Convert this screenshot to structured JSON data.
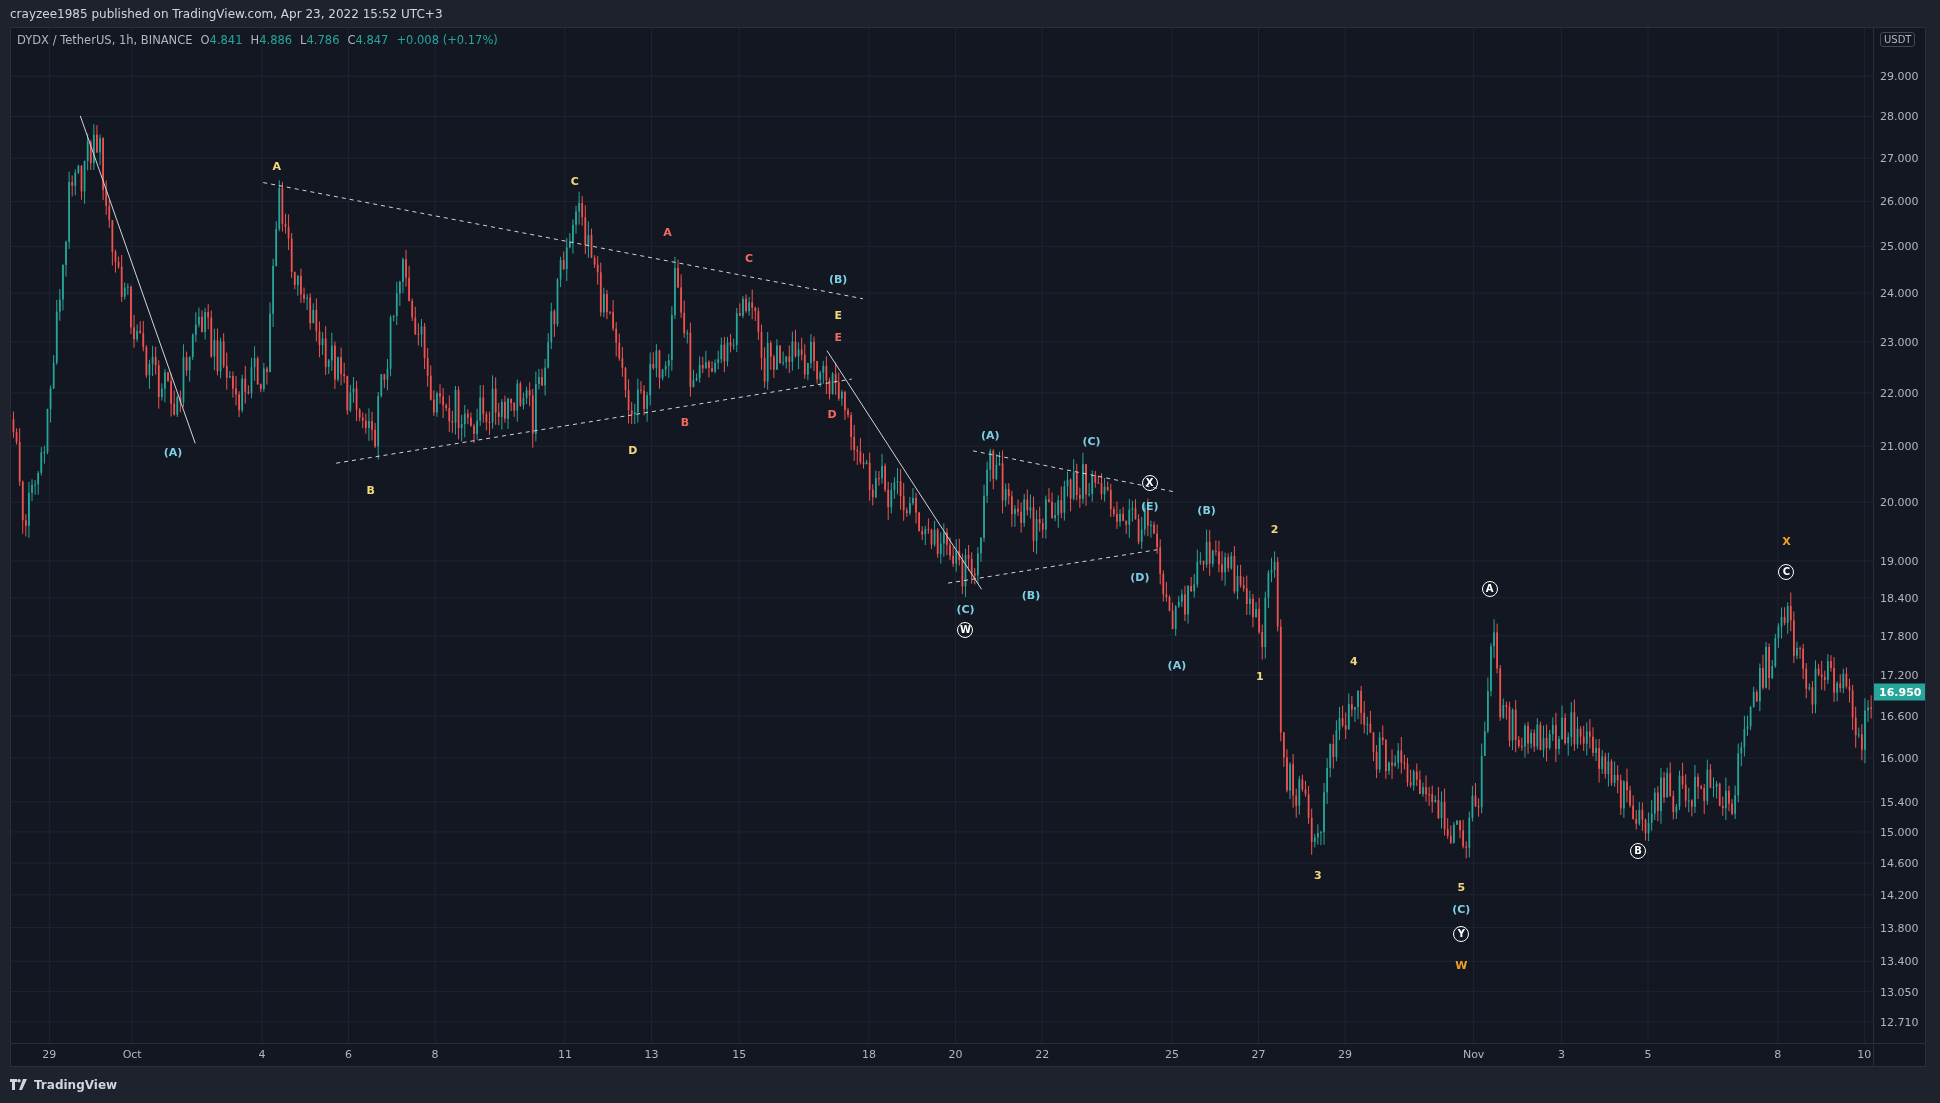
{
  "header": {
    "text": "crayzee1985 published on TradingView.com, Apr 23, 2022 15:52 UTC+3"
  },
  "legend": {
    "symbol": "DYDX / TetherUS, 1h, BINANCE",
    "fields": [
      {
        "key": "O",
        "value": "4.841"
      },
      {
        "key": "H",
        "value": "4.886"
      },
      {
        "key": "L",
        "value": "4.786"
      },
      {
        "key": "C",
        "value": "4.847"
      }
    ],
    "change": "+0.008 (+0.17%)"
  },
  "price_axis": {
    "currency": "USDT",
    "ticks": [
      "29.000",
      "28.000",
      "27.000",
      "26.000",
      "25.000",
      "24.000",
      "23.000",
      "22.000",
      "21.000",
      "20.000",
      "19.000",
      "18.400",
      "17.800",
      "17.200",
      "16.600",
      "16.000",
      "15.400",
      "15.000",
      "14.600",
      "14.200",
      "13.800",
      "13.400",
      "13.050",
      "12.710"
    ],
    "last_price": "16.950"
  },
  "time_axis": {
    "ticks": [
      "29",
      "Oct",
      "4",
      "6",
      "8",
      "11",
      "13",
      "15",
      "18",
      "20",
      "22",
      "25",
      "27",
      "29",
      "Nov",
      "3",
      "5",
      "8",
      "10"
    ]
  },
  "wave_labels": [
    {
      "text": "(A)",
      "kind": "plain",
      "color": "#7dcfe3"
    },
    {
      "text": "A",
      "kind": "plain",
      "color": "#f3d97a"
    },
    {
      "text": "B",
      "kind": "plain",
      "color": "#f3d97a"
    },
    {
      "text": "C",
      "kind": "plain",
      "color": "#f3d97a"
    },
    {
      "text": "D",
      "kind": "plain",
      "color": "#f3d97a"
    },
    {
      "text": "A",
      "kind": "plain",
      "color": "#f06a62"
    },
    {
      "text": "B",
      "kind": "plain",
      "color": "#f06a62"
    },
    {
      "text": "C",
      "kind": "plain",
      "color": "#f06a62"
    },
    {
      "text": "D",
      "kind": "plain",
      "color": "#f06a62"
    },
    {
      "text": "(B)",
      "kind": "plain",
      "color": "#7dcfe3"
    },
    {
      "text": "E",
      "kind": "plain",
      "color": "#f3d97a"
    },
    {
      "text": "E",
      "kind": "plain",
      "color": "#f06a62"
    },
    {
      "text": "(A)",
      "kind": "plain",
      "color": "#7dcfe3"
    },
    {
      "text": "(C)",
      "kind": "plain",
      "color": "#7dcfe3"
    },
    {
      "text": "X",
      "kind": "circled",
      "color": "#ffffff"
    },
    {
      "text": "(E)",
      "kind": "plain",
      "color": "#7dcfe3"
    },
    {
      "text": "(B)",
      "kind": "plain",
      "color": "#7dcfe3"
    },
    {
      "text": "(D)",
      "kind": "plain",
      "color": "#7dcfe3"
    },
    {
      "text": "(C)",
      "kind": "plain",
      "color": "#7dcfe3"
    },
    {
      "text": "W",
      "kind": "circled",
      "color": "#ffffff"
    },
    {
      "text": "(B)",
      "kind": "plain",
      "color": "#7dcfe3"
    },
    {
      "text": "(A)",
      "kind": "plain",
      "color": "#7dcfe3"
    },
    {
      "text": "2",
      "kind": "plain",
      "color": "#f3d97a"
    },
    {
      "text": "1",
      "kind": "plain",
      "color": "#f3d97a"
    },
    {
      "text": "4",
      "kind": "plain",
      "color": "#f3d97a"
    },
    {
      "text": "3",
      "kind": "plain",
      "color": "#f3d97a"
    },
    {
      "text": "A",
      "kind": "circled",
      "color": "#ffffff"
    },
    {
      "text": "5",
      "kind": "plain",
      "color": "#f3d97a"
    },
    {
      "text": "(C)",
      "kind": "plain",
      "color": "#7dcfe3"
    },
    {
      "text": "Y",
      "kind": "circled",
      "color": "#ffffff"
    },
    {
      "text": "W",
      "kind": "plain",
      "color": "#f0a020"
    },
    {
      "text": "B",
      "kind": "circled",
      "color": "#ffffff"
    },
    {
      "text": "X",
      "kind": "plain",
      "color": "#f0a020"
    },
    {
      "text": "C",
      "kind": "circled",
      "color": "#ffffff"
    }
  ],
  "footer": {
    "brand": "TradingView"
  }
}
